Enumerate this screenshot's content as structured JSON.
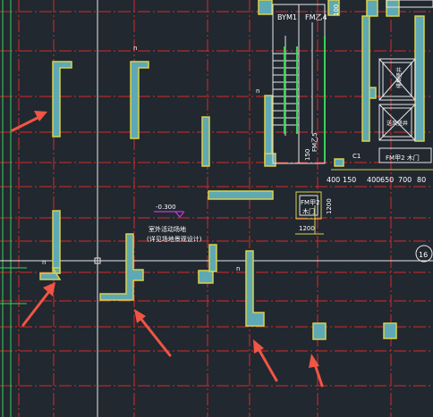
{
  "drawing": {
    "labels": {
      "stair_tag": "BYM1",
      "fire_door_top": "FM乙4",
      "fire_door_side": "FM乙5",
      "fire_door_box_code": "FM甲2",
      "fire_door_box_sub": "木门",
      "fire_door_right": "FM甲2 木门",
      "small_c1": "C1",
      "elevator_upper": "排烟竖井",
      "elevator_lower": "送风竖井",
      "elevation_mark": "-0.300",
      "note_line1": "室外活动场地",
      "note_line2": "(详见场地景观设计)",
      "dim_1200_bottom": "1200",
      "dim_1200_side": "1200",
      "dim_150": "150",
      "dim_100": "100",
      "axis_num": "16",
      "n_tag": "n"
    },
    "dimension_row": [
      "400",
      "150",
      "400",
      "650",
      "700",
      "80"
    ],
    "colors": {
      "background": "#212830",
      "axis_line": "#d62a2a",
      "wall_fill": "#5fa9b5",
      "wall_outline": "#d8d24a",
      "green_line": "#3fd15a",
      "white_line": "#e8e8e8",
      "arrow": "#f05545",
      "magenta": "#c13bd6"
    }
  }
}
